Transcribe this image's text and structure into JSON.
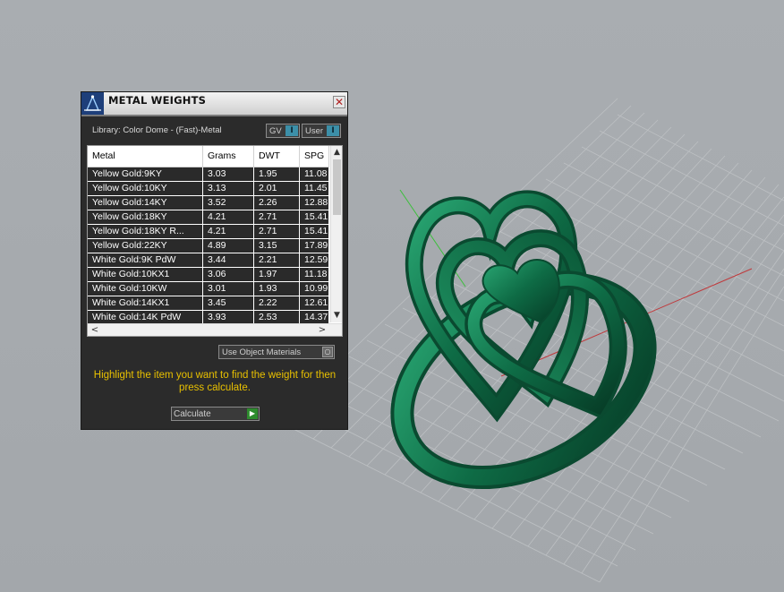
{
  "panel": {
    "title": "METAL WEIGHTS",
    "library_label": "Library: Color Dome - (Fast)-Metal",
    "gv_toggle_label": "GV",
    "user_toggle_label": "User",
    "use_materials_label": "Use Object Materials",
    "instructions": "Highlight the item you want to find the weight for then press calculate.",
    "calculate_label": "Calculate"
  },
  "table": {
    "columns": [
      "Metal",
      "Grams",
      "DWT",
      "SPG"
    ],
    "rows": [
      [
        "Yellow Gold:9KY",
        "3.03",
        "1.95",
        "11.08"
      ],
      [
        "Yellow Gold:10KY",
        "3.13",
        "2.01",
        "11.45"
      ],
      [
        "Yellow Gold:14KY",
        "3.52",
        "2.26",
        "12.88"
      ],
      [
        "Yellow Gold:18KY",
        "4.21",
        "2.71",
        "15.41"
      ],
      [
        "Yellow Gold:18KY R...",
        "4.21",
        "2.71",
        "15.41"
      ],
      [
        "Yellow Gold:22KY",
        "4.89",
        "3.15",
        "17.89"
      ],
      [
        "White Gold:9K PdW",
        "3.44",
        "2.21",
        "12.59"
      ],
      [
        "White Gold:10KX1",
        "3.06",
        "1.97",
        "11.18"
      ],
      [
        "White Gold:10KW",
        "3.01",
        "1.93",
        "10.99"
      ],
      [
        "White Gold:14KX1",
        "3.45",
        "2.22",
        "12.61"
      ],
      [
        "White Gold:14K PdW",
        "3.93",
        "2.53",
        "14.37"
      ]
    ]
  },
  "colors": {
    "viewport_bg": "#a8acb0",
    "ring_color": "#0e6b45",
    "instructions_color": "#e8c000"
  }
}
